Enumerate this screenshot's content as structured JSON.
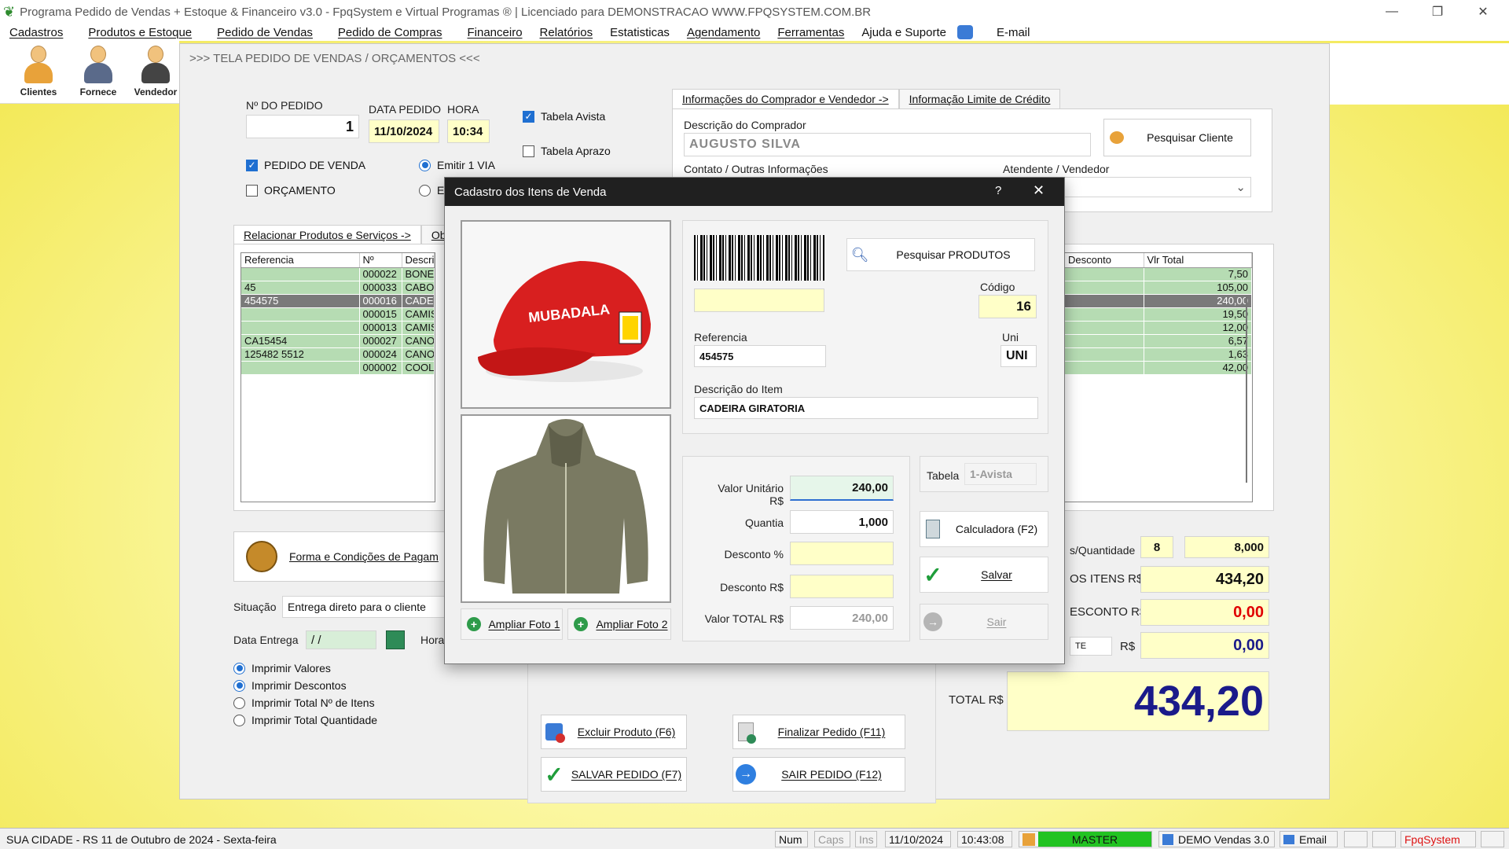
{
  "window": {
    "title": "Programa Pedido de Vendas + Estoque & Financeiro v3.0 - FpqSystem e Virtual Programas ® | Licenciado para  DEMONSTRACAO WWW.FPQSYSTEM.COM.BR"
  },
  "menu": [
    "Cadastros",
    "Produtos e Estoque",
    "Pedido de Vendas",
    "Pedido de Compras",
    "Financeiro",
    "Relatórios",
    "Estatisticas",
    "Agendamento",
    "Ferramentas",
    "Ajuda e Suporte",
    "E-mail"
  ],
  "toolbar": {
    "clientes": "Clientes",
    "fornece": "Fornece",
    "vendedor": "Vendedor"
  },
  "screen_header": ">>>  TELA PEDIDO DE VENDAS / ORÇAMENTOS  <<<",
  "order": {
    "numero_label": "Nº DO PEDIDO",
    "numero": "1",
    "data_label": "DATA PEDIDO",
    "data": "11/10/2024",
    "hora_label": "HORA",
    "hora": "10:34",
    "tabela_avista": "Tabela Avista",
    "tabela_aprazo": "Tabela Aprazo",
    "pedido_venda": "PEDIDO DE VENDA",
    "orcamento": "ORÇAMENTO",
    "emitir_1via": "Emitir 1 VIA",
    "emitir_2_partial": "Er"
  },
  "buyer": {
    "tab1": "Informações do Comprador e Vendedor  ->",
    "tab2": "Informação Limite de Crédito",
    "desc_label": "Descrição do Comprador",
    "nome": "AUGUSTO SILVA",
    "pesquisar": "Pesquisar Cliente",
    "contato_label": "Contato / Outras Informações",
    "atendente_label": "Atendente / Vendedor"
  },
  "items_tab": {
    "tab1": "Relacionar Produtos e Serviços  ->",
    "tab2": "Obs",
    "tab3_tail": ")"
  },
  "grid_left": {
    "headers": [
      "Referencia",
      "Nº",
      "Descri"
    ],
    "rows": [
      [
        "",
        "000022",
        "BONE"
      ],
      [
        "45",
        "000033",
        "CABO"
      ],
      [
        "454575",
        "000016",
        "CADE"
      ],
      [
        "",
        "000015",
        "CAMIS"
      ],
      [
        "",
        "000013",
        "CAMIS"
      ],
      [
        "CA15454",
        "000027",
        "CANO"
      ],
      [
        "125482 5512",
        "000024",
        "CANO"
      ],
      [
        "",
        "000002",
        "COOLE"
      ]
    ],
    "selected": 2
  },
  "grid_right": {
    "headers": [
      "Desconto",
      "Vlr Total"
    ],
    "rows": [
      [
        "",
        "7,50"
      ],
      [
        "",
        "105,00"
      ],
      [
        "",
        "240,00"
      ],
      [
        "",
        "19,50"
      ],
      [
        "",
        "12,00"
      ],
      [
        "",
        "6,57"
      ],
      [
        "",
        "1,63"
      ],
      [
        "",
        "42,00"
      ]
    ]
  },
  "forma_pagamento": "Forma e Condições de Pagam",
  "situacao_label": "Situação",
  "situacao": "Entrega direto para o cliente",
  "data_entrega_label": "Data Entrega",
  "data_entrega": " / /",
  "hora_label2": "Hora",
  "print_opts": [
    "Imprimir Valores",
    "Imprimir Descontos",
    "Imprimir Total Nº de Itens",
    "Imprimir Total Quantidade"
  ],
  "actions": {
    "excluir": "Excluir Produto  (F6)",
    "finalizar": "Finalizar Pedido  (F11)",
    "salvar": "SALVAR PEDIDO  (F7)",
    "sair": "SAIR  PEDIDO  (F12)"
  },
  "totals": {
    "qtd_label": "s/Quantidade",
    "qtd_itens": "8",
    "qtd_total": "8,000",
    "itens_label": "OS ITENS R$",
    "itens": "434,20",
    "desconto_label": "ESCONTO R$",
    "desconto": "0,00",
    "te_label": "TE",
    "rs_label": "R$",
    "outro": "0,00",
    "total_label": "TOTAL R$",
    "total": "434,20"
  },
  "modal": {
    "title": "Cadastro dos Itens de Venda",
    "help": "?",
    "pesquisar": "Pesquisar PRODUTOS",
    "codigo_label": "Código",
    "codigo": "16",
    "referencia_label": "Referencia",
    "referencia": "454575",
    "uni_label": "Uni",
    "uni": "UNI",
    "descricao_label": "Descrição do Item",
    "descricao": "CADEIRA GIRATORIA",
    "valor_unit_label": "Valor Unitário R$",
    "valor_unit": "240,00",
    "quantia_label": "Quantia",
    "quantia": "1,000",
    "desc_pct_label": "Desconto %",
    "desc_pct": "",
    "desc_rs_label": "Desconto R$",
    "desc_rs": "",
    "valor_total_label": "Valor TOTAL R$",
    "valor_total": "240,00",
    "tabela_label": "Tabela",
    "tabela": "1-Avista",
    "calculadora": "Calculadora (F2)",
    "salvar": "Salvar",
    "sair": "Sair",
    "ampliar1": "Ampliar Foto 1",
    "ampliar2": "Ampliar Foto 2",
    "cap_text": "MUBADALA"
  },
  "status": {
    "city": "SUA CIDADE - RS 11 de Outubro de 2024 - Sexta-feira",
    "num": "Num",
    "caps": "Caps",
    "ins": "Ins",
    "date": "11/10/2024",
    "time": "10:43:08",
    "user": "MASTER",
    "demo": "DEMO Vendas 3.0",
    "email": "Email",
    "brand": "FpqSystem"
  }
}
